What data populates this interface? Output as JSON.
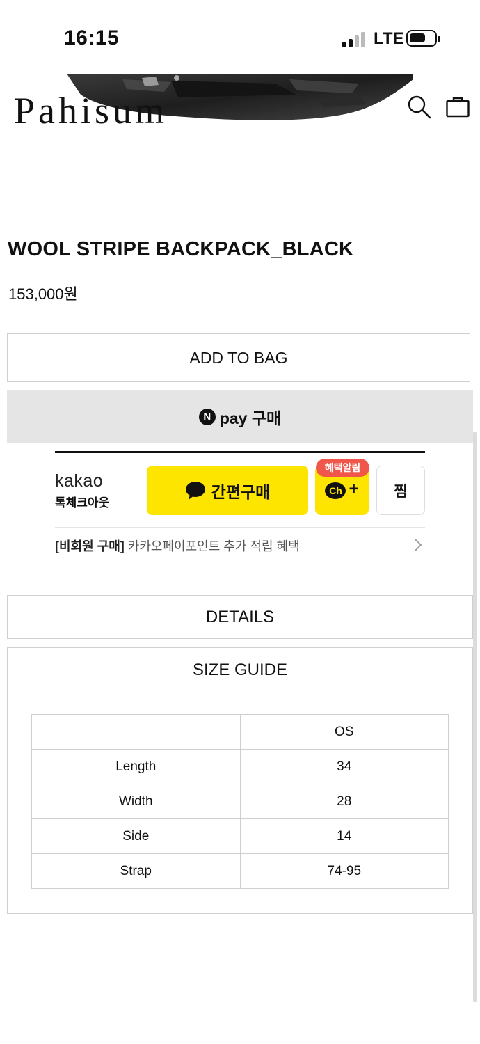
{
  "status_bar": {
    "time": "16:15",
    "network": "LTE",
    "signal_bars_active": 2,
    "signal_bars_total": 4
  },
  "header": {
    "logo": "Pahisum",
    "icons": [
      "search-icon",
      "shopping-bag-icon"
    ]
  },
  "product": {
    "title": "WOOL STRIPE BACKPACK_BLACK",
    "price": "153,000원"
  },
  "actions": {
    "add_to_bag": "ADD TO BAG",
    "npay_badge": "N",
    "npay_label": "pay 구매"
  },
  "kakao": {
    "logo_text": "kakao",
    "logo_subtext": "톡체크아웃",
    "buy_label": "간편구매",
    "benefit_badge": "혜택알림",
    "channel_label": "Ch",
    "channel_plus": "+",
    "wish_label": "찜",
    "promo_prefix": "[비회원 구매]",
    "promo_text": " 카카오페이포인트 추가 적립 혜택",
    "brand_color": "#fee500",
    "badge_color": "#f0564a"
  },
  "sections": {
    "details": "DETAILS",
    "size_guide": "SIZE GUIDE"
  },
  "size_table": {
    "header": [
      "",
      "OS"
    ],
    "rows": [
      [
        "Length",
        "34"
      ],
      [
        "Width",
        "28"
      ],
      [
        "Side",
        "14"
      ],
      [
        "Strap",
        "74-95"
      ]
    ]
  }
}
